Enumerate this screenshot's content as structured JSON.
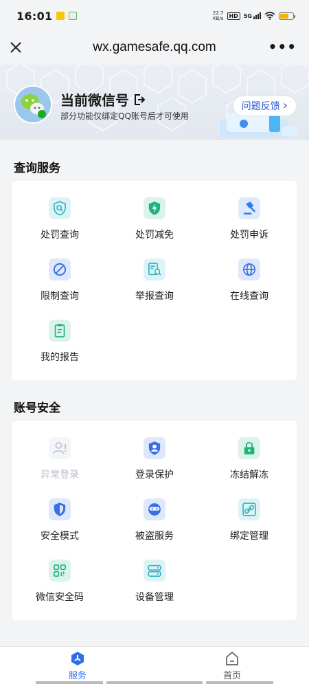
{
  "status_bar": {
    "time": "16:01",
    "speed_value": "22.7",
    "speed_unit": "KB/s",
    "hd": "HD",
    "signal": "5G"
  },
  "nav": {
    "title": "wx.gamesafe.qq.com",
    "more": "•••"
  },
  "account": {
    "title": "当前微信号",
    "subtitle": "部分功能仅绑定QQ账号后才可使用",
    "feedback_label": "问题反馈",
    "feedback_chevron": "›"
  },
  "query_section": {
    "title": "查询服务",
    "items": [
      {
        "label": "处罚查询",
        "icon": "search-shield-icon",
        "color": "#2ab3c6"
      },
      {
        "label": "处罚减免",
        "icon": "lightning-shield-icon",
        "color": "#1fb57a"
      },
      {
        "label": "处罚申诉",
        "icon": "gavel-icon",
        "color": "#2f7be8"
      },
      {
        "label": "限制查询",
        "icon": "restrict-icon",
        "color": "#3b6ee6"
      },
      {
        "label": "举报查询",
        "icon": "report-search-icon",
        "color": "#2ab3c6"
      },
      {
        "label": "在线查询",
        "icon": "globe-icon",
        "color": "#3b6ee6"
      },
      {
        "label": "我的报告",
        "icon": "clipboard-icon",
        "color": "#1fb57a"
      }
    ]
  },
  "security_section": {
    "title": "账号安全",
    "items": [
      {
        "label": "异常登录",
        "icon": "user-alert-icon",
        "color": "#b8c2d4",
        "disabled": true
      },
      {
        "label": "登录保护",
        "icon": "user-shield-icon",
        "color": "#3b6ee6"
      },
      {
        "label": "冻结解冻",
        "icon": "lock-icon",
        "color": "#1fb57a"
      },
      {
        "label": "安全模式",
        "icon": "safe-mode-shield-icon",
        "color": "#3b6ee6"
      },
      {
        "label": "被盗服务",
        "icon": "thief-mask-icon",
        "color": "#3b6ee6"
      },
      {
        "label": "绑定管理",
        "icon": "link-icon",
        "color": "#2ab3c6"
      },
      {
        "label": "微信安全码",
        "icon": "qr-code-icon",
        "color": "#1fb57a"
      },
      {
        "label": "设备管理",
        "icon": "devices-icon",
        "color": "#2ab3c6"
      }
    ]
  },
  "tabbar": {
    "tabs": [
      {
        "label": "服务",
        "icon": "service-icon",
        "active": true
      },
      {
        "label": "首页",
        "icon": "home-icon",
        "active": false
      }
    ],
    "active_color": "#2f6ee8"
  }
}
